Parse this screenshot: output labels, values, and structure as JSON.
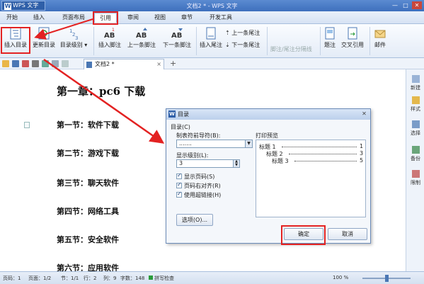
{
  "titlebar": {
    "app_name": "WPS 文字",
    "title": "文档2 * - WPS 文字",
    "min": "—",
    "max": "□",
    "close": "✕"
  },
  "menu": {
    "items": [
      "开始",
      "插入",
      "页面布局",
      "引用",
      "审阅",
      "视图",
      "章节",
      "开发工具"
    ],
    "active_index": 3
  },
  "ribbon": {
    "insert_toc": "插入目录",
    "update_toc": "更新目录",
    "toc_level": "目录级别 ▾",
    "insert_footnote": "插入脚注",
    "prev_footnote": "上一条脚注",
    "next_footnote": "下一条脚注",
    "insert_endnote": "插入尾注",
    "prev_endnote": "上一条尾注",
    "next_endnote": "下一条尾注",
    "footnote_separator": "脚注/尾注分隔线",
    "caption": "题注",
    "cross_ref": "交叉引用",
    "mail": "邮件"
  },
  "doctab": {
    "name": "文档2 *",
    "close": "×",
    "add": "+"
  },
  "document": {
    "chapter": "第一章：pc6 下载",
    "sections": [
      "第一节：软件下载",
      "第二节：游戏下载",
      "第三节：聊天软件",
      "第四节：网络工具",
      "第五节：安全软件",
      "第六节：应用软件"
    ]
  },
  "rightpanel": {
    "items": [
      "新建",
      "样式",
      "选择",
      "备份",
      "限制"
    ]
  },
  "statusbar": {
    "page": "页码：1",
    "pages": "页面：1/2",
    "section": "节：1/1",
    "row": "行：2",
    "col": "列：9",
    "chars": "字数：148",
    "spell": "拼写检查",
    "zoom": "100 %"
  },
  "dialog": {
    "title": "目录",
    "toc_group": "目录(C)",
    "leader_label": "制表符前导符(B):",
    "leader_value": ".......",
    "levels_label": "显示级别(L):",
    "levels_value": "3",
    "preview_label": "打印预览",
    "options": [
      "显示页码(S)",
      "页码右对齐(R)",
      "使用超链接(H)"
    ],
    "options_button": "选项(O)...",
    "ok": "确定",
    "cancel": "取消",
    "preview_rows": [
      {
        "text": "标题 1",
        "page": "1"
      },
      {
        "text": "标题 2",
        "page": "3"
      },
      {
        "text": "标题 3",
        "page": "5"
      }
    ]
  },
  "colors": {
    "annotation": "#e32222",
    "titlebar": "#3d6fbd"
  }
}
